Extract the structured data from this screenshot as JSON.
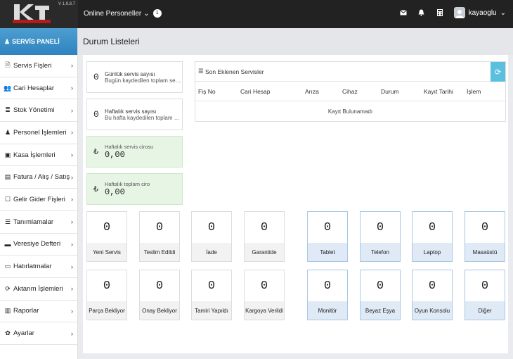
{
  "header": {
    "version": "V 1.9.8.7",
    "online_label": "Online Personeller",
    "online_count": "1",
    "username": "kayaoglu"
  },
  "sidebar": {
    "title": "SERVİS PANELİ",
    "items": [
      {
        "label": "Servis Fişleri",
        "icon": "document-icon"
      },
      {
        "label": "Cari Hesaplar",
        "icon": "users-icon"
      },
      {
        "label": "Stok Yönetimi",
        "icon": "database-icon"
      },
      {
        "label": "Personel İşlemleri",
        "icon": "user-icon"
      },
      {
        "label": "Kasa İşlemleri",
        "icon": "money-icon"
      },
      {
        "label": "Fatura / Alış / Satış",
        "icon": "invoice-icon"
      },
      {
        "label": "Gelir Gider Fişleri",
        "icon": "file-icon"
      },
      {
        "label": "Tanımlamalar",
        "icon": "list-icon"
      },
      {
        "label": "Veresiye Defteri",
        "icon": "book-icon"
      },
      {
        "label": "Hatırlatmalar",
        "icon": "calendar-icon"
      },
      {
        "label": "Aktarım İşlemleri",
        "icon": "sync-icon"
      },
      {
        "label": "Raporlar",
        "icon": "bar-chart-icon"
      },
      {
        "label": "Ayarlar",
        "icon": "gear-icon"
      }
    ]
  },
  "page": {
    "title": "Durum Listeleri"
  },
  "stats": [
    {
      "value": "0",
      "title": "Günlük servis sayısı",
      "subtitle": "Bugün kaydedilen toplam servis"
    },
    {
      "value": "0",
      "title": "Haftalık servis sayısı",
      "subtitle": "Bu hafta kaydedilen toplam se..."
    },
    {
      "currency": "₺",
      "title": "Haftalık servis cirosu",
      "value": "0,00"
    },
    {
      "currency": "₺",
      "title": "Haftalık toplam ciro",
      "value": "0,00"
    }
  ],
  "recent": {
    "title": "Son Eklenen Servisler",
    "columns": [
      "Fiş No",
      "Cari Hesap",
      "Arıza",
      "Cihaz",
      "Durum",
      "Kayıt Tarihi",
      "İşlem"
    ],
    "empty": "Kayıt Bulunamadı"
  },
  "status_tiles": [
    {
      "value": "0",
      "label": "Yeni Servis"
    },
    {
      "value": "0",
      "label": "Teslim Edildi"
    },
    {
      "value": "0",
      "label": "İade"
    },
    {
      "value": "0",
      "label": "Garantide"
    },
    {
      "value": "0",
      "label": "Parça Bekliyor"
    },
    {
      "value": "0",
      "label": "Onay Bekliyor"
    },
    {
      "value": "0",
      "label": "Tamiri Yapıldı"
    },
    {
      "value": "0",
      "label": "Kargoya Verildi"
    }
  ],
  "device_tiles": [
    {
      "value": "0",
      "label": "Tablet"
    },
    {
      "value": "0",
      "label": "Telefon"
    },
    {
      "value": "0",
      "label": "Laptop"
    },
    {
      "value": "0",
      "label": "Masaüstü"
    },
    {
      "value": "0",
      "label": "Monitör"
    },
    {
      "value": "0",
      "label": "Beyaz Eşya"
    },
    {
      "value": "0",
      "label": "Oyun Konsolu"
    },
    {
      "value": "0",
      "label": "Diğer"
    }
  ]
}
